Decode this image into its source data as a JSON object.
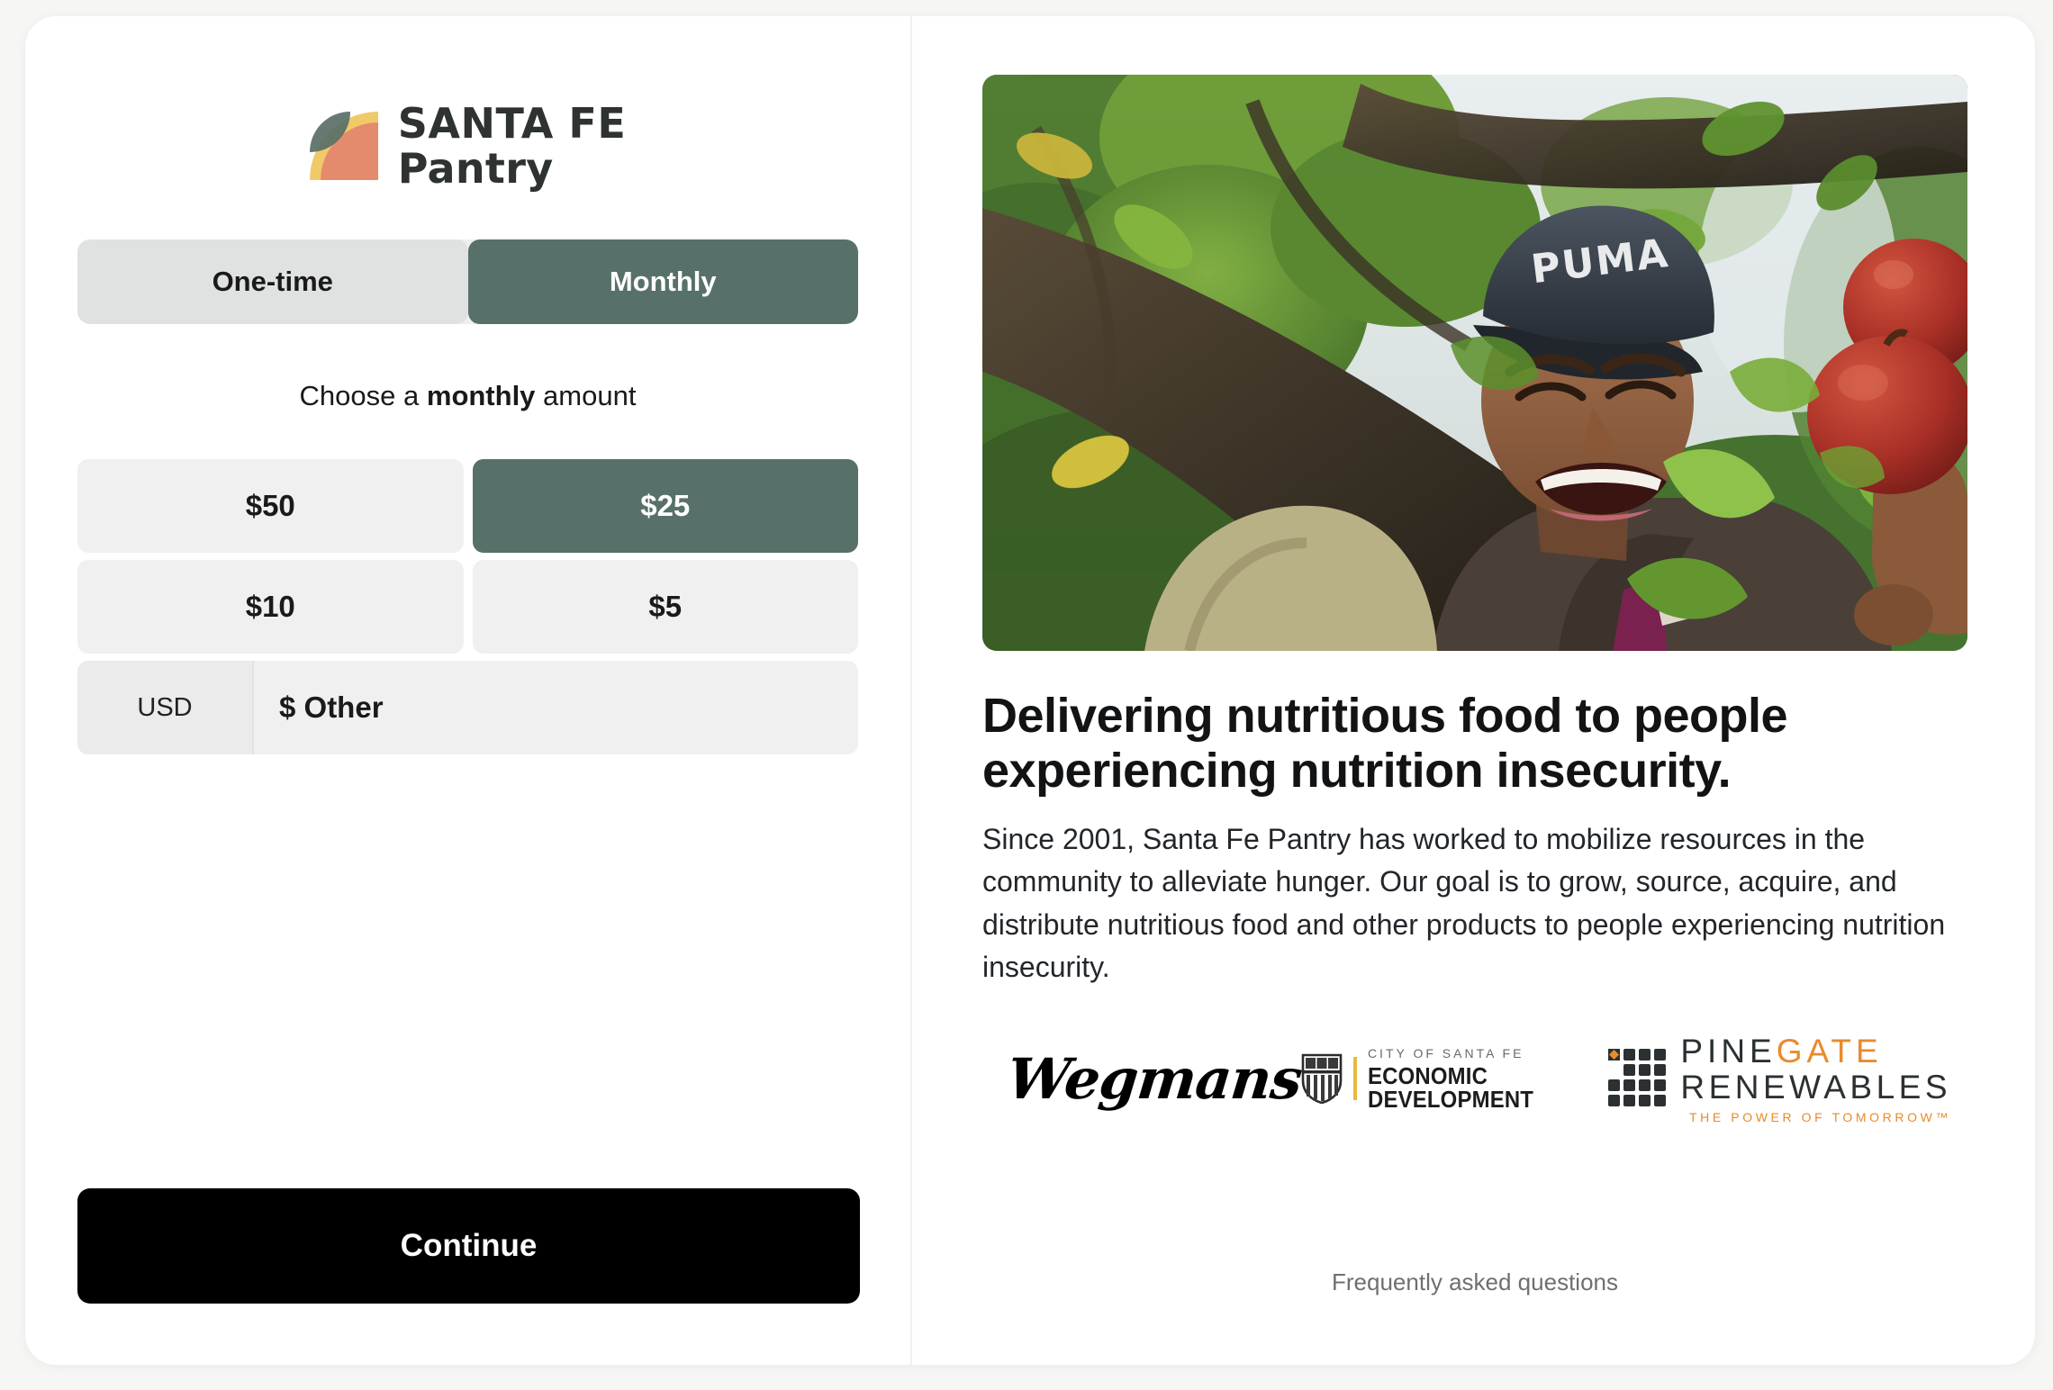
{
  "brand": {
    "name_line1": "SANTA FE",
    "name_line2": "Pantry",
    "logo_icon": "santa-fe-pantry-logo-mark",
    "accent_green": "#57706a",
    "logo_yellow": "#f0c969",
    "logo_salmon": "#e58b6d",
    "logo_leaf_green": "#5a7068"
  },
  "donation": {
    "frequency_options": [
      {
        "label": "One-time",
        "selected": false
      },
      {
        "label": "Monthly",
        "selected": true
      }
    ],
    "choose_prefix": "Choose a ",
    "choose_emphasis": "monthly",
    "choose_suffix": " amount",
    "amounts": [
      {
        "label": "$50",
        "selected": false
      },
      {
        "label": "$25",
        "selected": true
      },
      {
        "label": "$10",
        "selected": false
      },
      {
        "label": "$5",
        "selected": false
      }
    ],
    "currency": "USD",
    "other_value": "",
    "other_placeholder": "$ Other",
    "continue_label": "Continue"
  },
  "story": {
    "hero_image_alt": "smiling-man-picking-red-apples-in-tree",
    "hero_cap_text": "PUMA",
    "headline": "Delivering nutritious food to people experiencing nutrition insecurity.",
    "body": "Since 2001, Santa Fe Pantry has worked to mobilize resources in the community to alleviate hunger. Our goal is to grow, source, acquire, and distribute nutritious food and other products to people experiencing nutrition insecurity."
  },
  "sponsors": [
    {
      "id": "wegmans",
      "name": "Wegmans"
    },
    {
      "id": "city-of-santa-fe-economic-development",
      "top_line": "CITY OF SANTA FE",
      "bottom_line": "ECONOMIC DEVELOPMENT",
      "bar_color": "#e8b93f"
    },
    {
      "id": "pine-gate-renewables",
      "word1": "PINE",
      "word2": "GATE",
      "word3": "RENEWABLES",
      "tagline": "THE POWER OF TOMORROW™",
      "accent_color": "#e98a2b"
    }
  ],
  "footer": {
    "faq_label": "Frequently asked questions"
  }
}
